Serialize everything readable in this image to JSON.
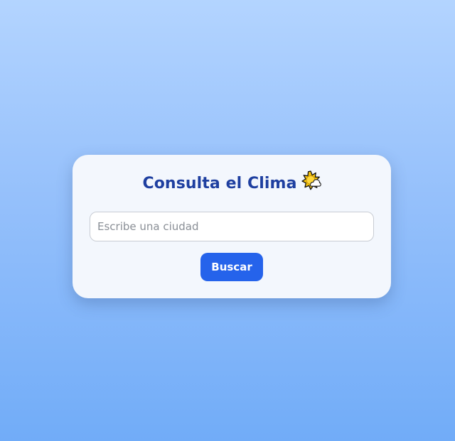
{
  "weather_card": {
    "title": "Consulta el Clima",
    "title_icon": "sun-behind-cloud-icon",
    "search": {
      "placeholder": "Escribe una ciudad",
      "value": ""
    },
    "search_button_label": "Buscar"
  },
  "colors": {
    "background_top": "#b3d4ff",
    "background_bottom": "#71acf8",
    "card_background": "#f3f7fd",
    "title": "#1e3fa0",
    "button": "#2563eb",
    "button_text": "#ffffff"
  }
}
